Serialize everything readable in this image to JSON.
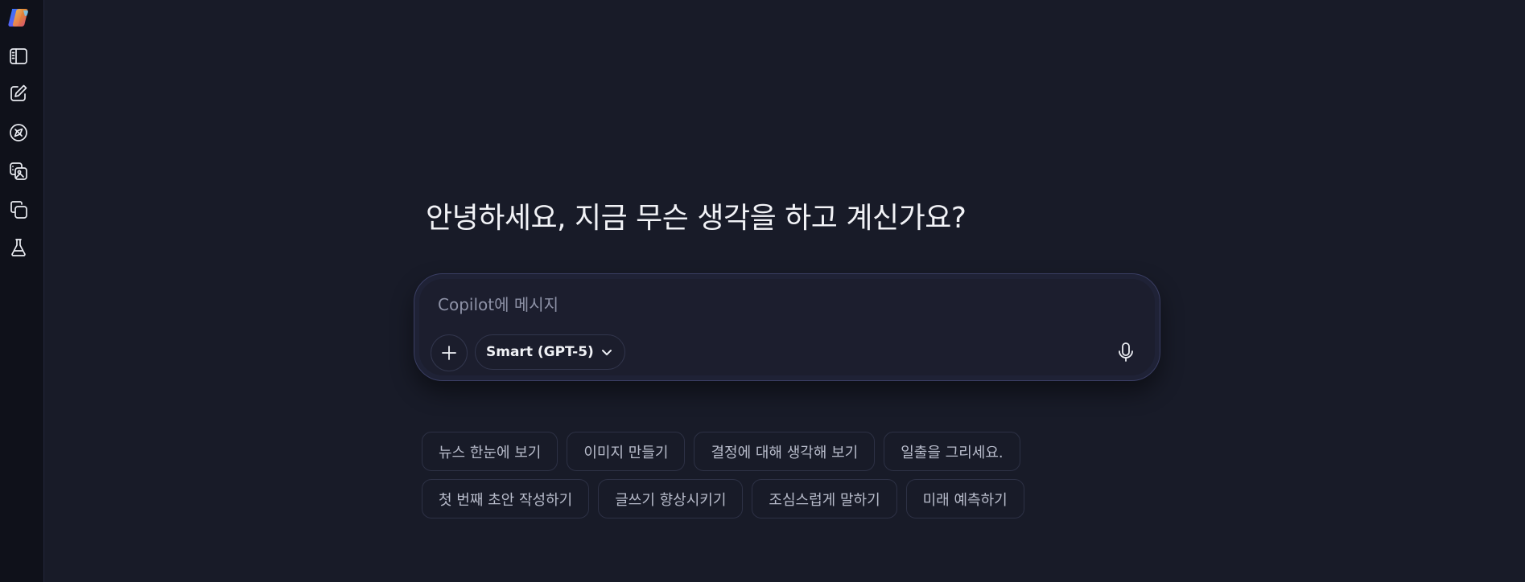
{
  "sidebar": {
    "items": [
      {
        "icon": "copilot-logo-icon"
      },
      {
        "icon": "sidebar-toggle-icon"
      },
      {
        "icon": "new-chat-icon"
      },
      {
        "icon": "discover-icon"
      },
      {
        "icon": "image-gallery-icon"
      },
      {
        "icon": "pages-icon"
      },
      {
        "icon": "labs-icon"
      }
    ]
  },
  "main": {
    "greeting": "안녕하세요, 지금 무슨 생각을 하고 계신가요?",
    "composer": {
      "placeholder": "Copilot에 메시지",
      "value": "",
      "model_label": "Smart (GPT-5)"
    },
    "suggestions_row1": [
      "뉴스 한눈에 보기",
      "이미지 만들기",
      "결정에 대해 생각해 보기",
      "일출을 그리세요."
    ],
    "suggestions_row2": [
      "첫 번째 초안 작성하기",
      "글쓰기 향상시키기",
      "조심스럽게 말하기",
      "미래 예측하기"
    ]
  },
  "colors": {
    "background": "#181b28",
    "rail": "#0f111a",
    "accent_border": "#3a3e63"
  }
}
